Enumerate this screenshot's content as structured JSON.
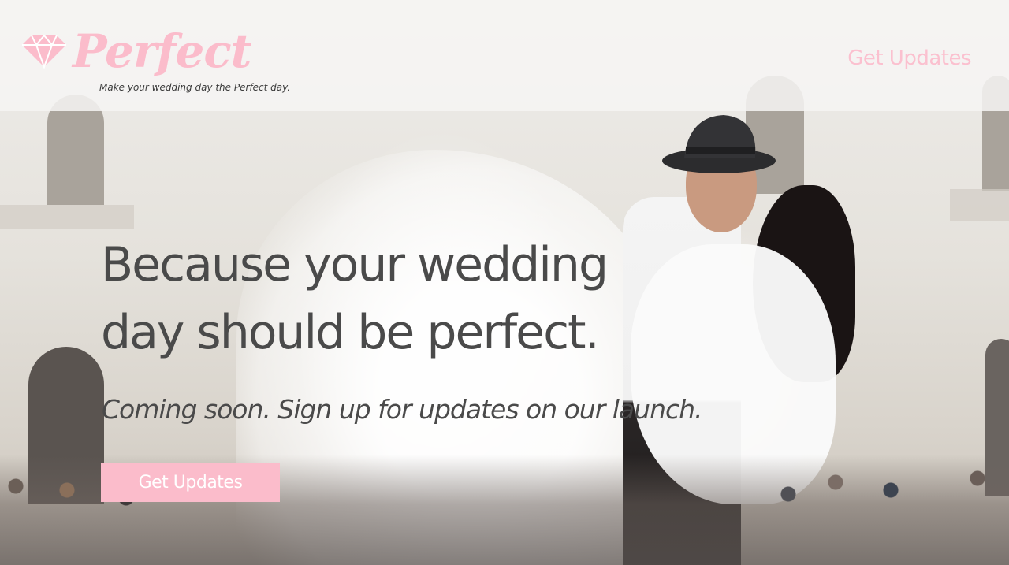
{
  "brand": {
    "name": "Perfect",
    "tagline": "Make your wedding day the Perfect day.",
    "logo_icon": "diamond-icon",
    "accent_color": "#fbbccb"
  },
  "header": {
    "cta_label": "Get Updates"
  },
  "hero": {
    "headline_line1": "Because your wedding",
    "headline_line2": "day should be perfect.",
    "subheadline": "Coming soon. Sign up for updates on our launch.",
    "cta_label": "Get Updates",
    "text_color": "#4a4a4a"
  }
}
